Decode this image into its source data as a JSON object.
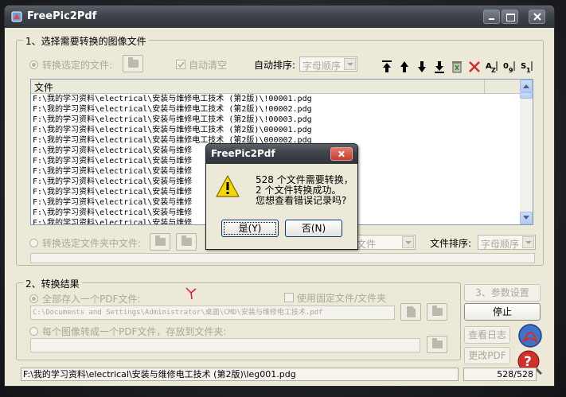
{
  "window": {
    "title": "FreePic2Pdf"
  },
  "section1": {
    "title": "1、选择需要转换的图像文件",
    "radio_files_label": "转换选定的文件:",
    "auto_clear_label": "自动清空",
    "auto_sort_label": "自动排序:",
    "auto_sort_value": "字母顺序",
    "column_header": "文件",
    "rows": [
      "F:\\我的学习资料\\electrical\\安装与维修电工技术 (第2版)\\!00001.pdg",
      "F:\\我的学习资料\\electrical\\安装与维修电工技术 (第2版)\\!00002.pdg",
      "F:\\我的学习资料\\electrical\\安装与维修电工技术 (第2版)\\!00003.pdg",
      "F:\\我的学习资料\\electrical\\安装与维修电工技术 (第2版)\\000001.pdg",
      "F:\\我的学习资料\\electrical\\安装与维修电工技术 (第2版)\\000002.pdg",
      "F:\\我的学习资料\\electrical\\安装与维修",
      "F:\\我的学习资料\\electrical\\安装与维修",
      "F:\\我的学习资料\\electrical\\安装与维修",
      "F:\\我的学习资料\\electrical\\安装与维修",
      "F:\\我的学习资料\\electrical\\安装与维修",
      "F:\\我的学习资料\\electrical\\安装与维修",
      "F:\\我的学习资料\\electrical\\安装与维修",
      "F:\\我的学习资料\\electrical\\安装与维修"
    ],
    "radio_folder_label": "转换选定文件夹中文件:",
    "folder_combo_value": "文件",
    "file_sort_label": "文件排序:",
    "file_sort_value": "字母顺序"
  },
  "section2": {
    "title": "2、转换结果",
    "radio_all_label": "全部存入一个PDF文件:",
    "fixed_file_label": "使用固定文件/文件夹",
    "output_path": "C:\\Documents and Settings\\Administrator\\桌面\\CMD\\安装与维修电工技术.pdf",
    "radio_each_label": "每个图像转成一个PDF文件，存放到文件夹:"
  },
  "buttons": {
    "params": "3、参数设置",
    "stop": "停止",
    "view_log": "查看日志",
    "edit_pdf": "更改PDF"
  },
  "status": {
    "current_file": "F:\\我的学习资料\\electrical\\安装与维修电工技术 (第2版)\\leg001.pdg",
    "progress_text": "528/528"
  },
  "dialog": {
    "title": "FreePic2Pdf",
    "line1": "528 个文件需要转换，",
    "line2": "2 个文件转换成功。",
    "line3": "您想查看错误记录吗?",
    "yes": "是(Y)",
    "no": "否(N)"
  },
  "colors": {
    "title_bar": "#3e434b",
    "warning": "#f5d800",
    "red": "#d0302a"
  }
}
